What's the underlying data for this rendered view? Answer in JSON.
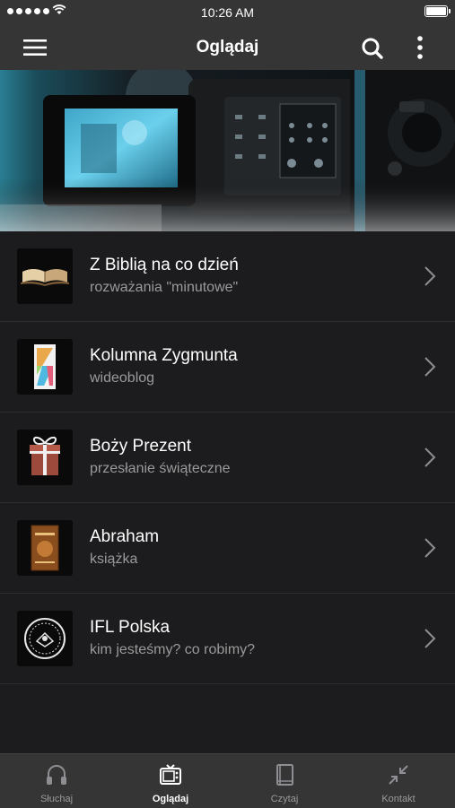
{
  "status_bar": {
    "time": "10:26 AM"
  },
  "nav": {
    "title": "Oglądaj"
  },
  "items": [
    {
      "title": "Z Biblią na co dzień",
      "subtitle": "rozważania \"minutowe\"",
      "icon": "open-bible-icon"
    },
    {
      "title": "Kolumna Zygmunta",
      "subtitle": "wideoblog",
      "icon": "kz-logo-icon"
    },
    {
      "title": "Boży Prezent",
      "subtitle": "przesłanie świąteczne",
      "icon": "gift-icon"
    },
    {
      "title": "Abraham",
      "subtitle": "książka",
      "icon": "book-cover-icon"
    },
    {
      "title": "IFL Polska",
      "subtitle": "kim jesteśmy? co robimy?",
      "icon": "ifl-seal-icon"
    }
  ],
  "tabs": [
    {
      "label": "Słuchaj",
      "icon": "headphones-icon",
      "active": false
    },
    {
      "label": "Oglądaj",
      "icon": "tv-icon",
      "active": true
    },
    {
      "label": "Czytaj",
      "icon": "book-icon",
      "active": false
    },
    {
      "label": "Kontakt",
      "icon": "contract-arrows-icon",
      "active": false
    }
  ],
  "colors": {
    "bar": "#353535",
    "background": "#1c1c1e",
    "subtitle": "#9a9a9a",
    "separator": "#2f2f31"
  }
}
